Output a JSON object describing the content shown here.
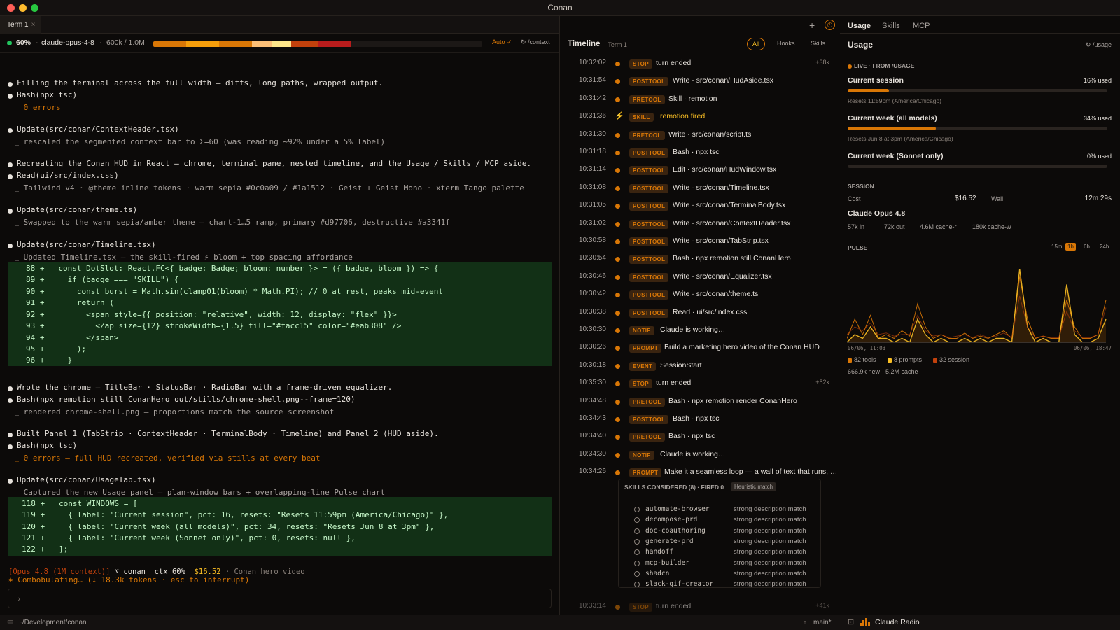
{
  "window": {
    "title": "Conan"
  },
  "tabs": {
    "term_label": "Term 1",
    "close": "×"
  },
  "context": {
    "percent": "60%",
    "model": "claude-opus-4-8",
    "tokens": "600k / 1.0M",
    "fill_fraction": 0.6,
    "auto_label": "Auto ✓",
    "context_label": "/context",
    "segments": [
      "#d97706",
      "#f59e0b",
      "#d97706",
      "#fbbf77",
      "#c2410c",
      "#b91c1c"
    ]
  },
  "terminal": {
    "l1": "Filling the terminal across the full width — diffs, long paths, wrapped output.",
    "l2": "Bash(npx tsc)",
    "l3": "⎿ 0 errors",
    "l4": "Update(src/conan/ContextHeader.tsx)",
    "l5": "⎿ rescaled the segmented context bar to Σ=60 (was reading ~92% under a 5% label)",
    "l6": "Recreating the Conan HUD in React — chrome, terminal pane, nested timeline, and the Usage / Skills / MCP aside.",
    "l7": "Read(ui/src/index.css)",
    "l8": "⎿ Tailwind v4 · @theme inline tokens · warm sepia #0c0a09 / #1a1512 · Geist + Geist Mono · xterm Tango palette",
    "l9": "Update(src/conan/theme.ts)",
    "l10": "⎿ Swapped to the warm sepia/amber theme — chart-1…5 ramp, primary #d97706, destructive #a3341f",
    "l11": "Update(src/conan/Timeline.tsx)",
    "l12": "⎿ Updated Timeline.tsx — the skill-fired ⚡ bloom + top spacing affordance",
    "diff1": [
      "88 +   const DotSlot: React.FC<{ badge: Badge; bloom: number }> = ({ badge, bloom }) => {",
      "89 +     if (badge === \"SKILL\") {",
      "90 +       const burst = Math.sin(clamp01(bloom) * Math.PI); // 0 at rest, peaks mid-event",
      "91 +       return (",
      "92 +         <span style={{ position: \"relative\", width: 12, display: \"flex\" }}>",
      "93 +           <Zap size={12} strokeWidth={1.5} fill=\"#facc15\" color=\"#eab308\" />",
      "94 +         </span>",
      "95 +       );",
      "96 +     }"
    ],
    "l13": "Wrote the chrome — TitleBar · StatusBar · RadioBar with a frame-driven equalizer.",
    "l14": "Bash(npx remotion still ConanHero out/stills/chrome-shell.png--frame=120)",
    "l15": "⎿ rendered chrome-shell.png — proportions match the source screenshot",
    "l16": "Built Panel 1 (TabStrip · ContextHeader · TerminalBody · Timeline) and Panel 2 (HUD aside).",
    "l17": "Bash(npx tsc)",
    "l18": "⎿ 0 errors — full HUD recreated, verified via stills at every beat",
    "l19": "Update(src/conan/UsageTab.tsx)",
    "l20": "⎿ Captured the new Usage panel — plan-window bars + overlapping-line Pulse chart",
    "diff2": [
      "118 +   const WINDOWS = [",
      "119 +     { label: \"Current session\", pct: 16, resets: \"Resets 11:59pm (America/Chicago)\" },",
      "120 +     { label: \"Current week (all models)\", pct: 34, resets: \"Resets Jun 8 at 3pm\" },",
      "121 +     { label: \"Current week (Sonnet only)\", pct: 0, resets: null },",
      "122 +   ];"
    ],
    "spinner": "✶ Combobulating… (↓ 18.3k tokens · esc to interrupt)",
    "prompt": "›",
    "status": {
      "model": "[Opus 4.8 (1M context)]",
      "branch": "⌥ conan",
      "ctx": "ctx 60%",
      "cost": "$16.52",
      "title": "· Conan hero video"
    }
  },
  "bottom": {
    "path": "~/Development/conan",
    "branch": "main*",
    "radio": "Claude Radio"
  },
  "timeline": {
    "title": "Timeline",
    "term": "· Term 1",
    "filters": [
      "All",
      "Hooks",
      "Skills"
    ],
    "rows": [
      {
        "time": "10:32:02",
        "badge": "STOP",
        "text": "turn ended",
        "meta": "+38k"
      },
      {
        "time": "10:31:54",
        "badge": "POSTTOOL",
        "text": "Write · src/conan/HudAside.tsx",
        "meta": ""
      },
      {
        "time": "10:31:42",
        "badge": "PRETOOL",
        "text": "Skill · remotion",
        "meta": ""
      },
      {
        "time": "10:31:36",
        "badge": "SKILL",
        "text": "remotion fired",
        "meta": ""
      },
      {
        "time": "10:31:30",
        "badge": "PRETOOL",
        "text": "Write · src/conan/script.ts",
        "meta": ""
      },
      {
        "time": "10:31:18",
        "badge": "POSTTOOL",
        "text": "Bash · npx tsc",
        "meta": ""
      },
      {
        "time": "10:31:14",
        "badge": "POSTTOOL",
        "text": "Edit · src/conan/HudWindow.tsx",
        "meta": ""
      },
      {
        "time": "10:31:08",
        "badge": "POSTTOOL",
        "text": "Write · src/conan/Timeline.tsx",
        "meta": ""
      },
      {
        "time": "10:31:05",
        "badge": "POSTTOOL",
        "text": "Write · src/conan/TerminalBody.tsx",
        "meta": ""
      },
      {
        "time": "10:31:02",
        "badge": "POSTTOOL",
        "text": "Write · src/conan/ContextHeader.tsx",
        "meta": ""
      },
      {
        "time": "10:30:58",
        "badge": "POSTTOOL",
        "text": "Write · src/conan/TabStrip.tsx",
        "meta": ""
      },
      {
        "time": "10:30:54",
        "badge": "POSTTOOL",
        "text": "Bash · npx remotion still ConanHero",
        "meta": ""
      },
      {
        "time": "10:30:46",
        "badge": "POSTTOOL",
        "text": "Write · src/conan/Equalizer.tsx",
        "meta": ""
      },
      {
        "time": "10:30:42",
        "badge": "POSTTOOL",
        "text": "Write · src/conan/theme.ts",
        "meta": ""
      },
      {
        "time": "10:30:38",
        "badge": "POSTTOOL",
        "text": "Read · ui/src/index.css",
        "meta": ""
      },
      {
        "time": "10:30:30",
        "badge": "NOTIF",
        "text": "Claude is working…",
        "meta": ""
      },
      {
        "time": "10:30:26",
        "badge": "PROMPT",
        "text": "Build a marketing hero video of the Conan HUD",
        "meta": ""
      },
      {
        "time": "10:30:18",
        "badge": "EVENT",
        "text": "SessionStart",
        "meta": ""
      },
      {
        "time": "10:35:30",
        "badge": "STOP",
        "text": "turn ended",
        "meta": "+52k"
      },
      {
        "time": "10:34:48",
        "badge": "PRETOOL",
        "text": "Bash · npx remotion render ConanHero",
        "meta": ""
      },
      {
        "time": "10:34:43",
        "badge": "POSTTOOL",
        "text": "Bash · npx tsc",
        "meta": ""
      },
      {
        "time": "10:34:40",
        "badge": "PRETOOL",
        "text": "Bash · npx tsc",
        "meta": ""
      },
      {
        "time": "10:34:30",
        "badge": "NOTIF",
        "text": "Claude is working…",
        "meta": ""
      },
      {
        "time": "10:34:26",
        "badge": "PROMPT",
        "text": "Make it a seamless loop — a wall of text that runs, …",
        "meta": ""
      }
    ],
    "skills_header": "SKILLS CONSIDERED (8) · FIRED 0",
    "skills_badge": "Heuristic match",
    "skills": [
      {
        "name": "automate-browser",
        "desc": "strong description match"
      },
      {
        "name": "decompose-prd",
        "desc": "strong description match"
      },
      {
        "name": "doc-coauthoring",
        "desc": "strong description match"
      },
      {
        "name": "generate-prd",
        "desc": "strong description match"
      },
      {
        "name": "handoff",
        "desc": "strong description match"
      },
      {
        "name": "mcp-builder",
        "desc": "strong description match"
      },
      {
        "name": "shadcn",
        "desc": "strong description match"
      },
      {
        "name": "slack-gif-creator",
        "desc": "strong description match"
      }
    ],
    "last": {
      "time": "10:33:14",
      "badge": "STOP",
      "text": "turn ended",
      "meta": "+41k"
    }
  },
  "usage": {
    "tabs": [
      "Usage",
      "Skills",
      "MCP"
    ],
    "title": "Usage",
    "refresh": "/usage",
    "live": "LIVE · FROM /USAGE",
    "windows": [
      {
        "label": "Current session",
        "pct": 0.16,
        "used": "16% used",
        "resets": "Resets 11:59pm (America/Chicago)"
      },
      {
        "label": "Current week (all models)",
        "pct": 0.34,
        "used": "34% used",
        "resets": "Resets Jun 8 at 3pm (America/Chicago)"
      },
      {
        "label": "Current week (Sonnet only)",
        "pct": 0.0,
        "used": "0% used",
        "resets": ""
      }
    ],
    "session_label": "SESSION",
    "cost_label": "Cost",
    "cost": "$16.52",
    "wall_label": "Wall",
    "wall": "12m 29s",
    "model": "Claude Opus 4.8",
    "tokens": [
      "57k in",
      "72k out",
      "4.6M cache-r",
      "180k cache-w"
    ],
    "pulse_label": "PULSE",
    "ranges": [
      "15m",
      "1h",
      "6h",
      "24h"
    ],
    "active_range": "1h",
    "x_start": "06/06, 11:03",
    "x_end": "06/06, 18:47",
    "legend": [
      {
        "label": "82 tools",
        "color": "#d97706"
      },
      {
        "label": "8 prompts",
        "color": "#fbbf24"
      },
      {
        "label": "32 session",
        "color": "#c2410c"
      }
    ],
    "footer": "666.9k new · 5.2M cache"
  },
  "chart_data": {
    "type": "line",
    "title": "",
    "xlabel": "",
    "ylabel": "",
    "x_range": [
      "06/06, 11:03",
      "06/06, 18:47"
    ],
    "series": [
      {
        "name": "82 tools",
        "values": [
          0.05,
          0.3,
          0.1,
          0.35,
          0.05,
          0.1,
          0.05,
          0.15,
          0.08,
          0.5,
          0.2,
          0.05,
          0.1,
          0.05,
          0.05,
          0.12,
          0.05,
          0.08,
          0.05,
          0.1,
          0.15,
          0.05,
          0.85,
          0.3,
          0.05,
          0.08,
          0.05,
          0.05,
          0.55,
          0.2,
          0.05,
          0.05,
          0.1,
          0.55
        ]
      },
      {
        "name": "8 prompts",
        "values": [
          0,
          0.1,
          0.05,
          0.2,
          0.05,
          0.05,
          0,
          0.05,
          0,
          0.3,
          0.1,
          0,
          0.05,
          0,
          0,
          0.05,
          0,
          0.05,
          0,
          0.05,
          0.05,
          0,
          0.95,
          0.2,
          0,
          0.05,
          0,
          0,
          0.75,
          0.1,
          0,
          0,
          0.05,
          0.3
        ]
      },
      {
        "name": "32 session",
        "values": [
          0.1,
          0.2,
          0.15,
          0.25,
          0.1,
          0.12,
          0.08,
          0.1,
          0.1,
          0.35,
          0.15,
          0.08,
          0.1,
          0.06,
          0.08,
          0.1,
          0.06,
          0.1,
          0.06,
          0.08,
          0.12,
          0.06,
          0.6,
          0.2,
          0.06,
          0.08,
          0.06,
          0.06,
          0.4,
          0.15,
          0.06,
          0.06,
          0.1,
          0.45
        ]
      }
    ]
  }
}
